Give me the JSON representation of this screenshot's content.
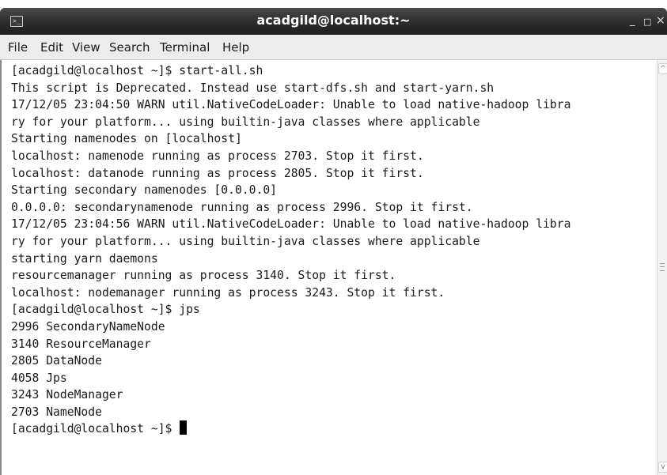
{
  "window": {
    "title": "acadgild@localhost:~",
    "icon": "terminal-icon",
    "icon_glyph": ">_",
    "controls": {
      "minimize_glyph": "_",
      "maximize_glyph": "□",
      "close_glyph": "×"
    }
  },
  "menu": {
    "items": [
      "File",
      "Edit",
      "View",
      "Search",
      "Terminal",
      "Help"
    ]
  },
  "terminal": {
    "lines": [
      "[acadgild@localhost ~]$ start-all.sh",
      "This script is Deprecated. Instead use start-dfs.sh and start-yarn.sh",
      "17/12/05 23:04:50 WARN util.NativeCodeLoader: Unable to load native-hadoop libra",
      "ry for your platform... using builtin-java classes where applicable",
      "Starting namenodes on [localhost]",
      "localhost: namenode running as process 2703. Stop it first.",
      "localhost: datanode running as process 2805. Stop it first.",
      "Starting secondary namenodes [0.0.0.0]",
      "0.0.0.0: secondarynamenode running as process 2996. Stop it first.",
      "17/12/05 23:04:56 WARN util.NativeCodeLoader: Unable to load native-hadoop libra",
      "ry for your platform... using builtin-java classes where applicable",
      "starting yarn daemons",
      "resourcemanager running as process 3140. Stop it first.",
      "localhost: nodemanager running as process 3243. Stop it first.",
      "[acadgild@localhost ~]$ jps",
      "2996 SecondaryNameNode",
      "3140 ResourceManager",
      "2805 DataNode",
      "4058 Jps",
      "3243 NodeManager",
      "2703 NameNode"
    ],
    "prompt": "[acadgild@localhost ~]$ "
  },
  "scrollbar": {
    "up_glyph": "^",
    "down_glyph": "v"
  },
  "colors": {
    "titlebar": "#2e2e2e",
    "menubar": "#ececec",
    "terminal_bg": "#ffffff",
    "terminal_fg": "#1a1a1a"
  }
}
